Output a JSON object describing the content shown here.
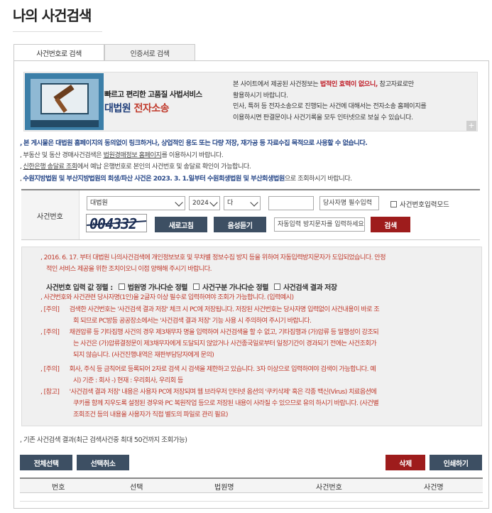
{
  "page": {
    "title": "나의 사건검색"
  },
  "tabs": [
    {
      "label": "사건번호로 검색",
      "active": true
    },
    {
      "label": "인증서로 검색",
      "active": false
    }
  ],
  "banner": {
    "tagline": "빠르고 편리한 고품질 사법서비스",
    "brand_part1": "대법원",
    "brand_part2": "전자소송",
    "text_line1_a": "본 사이트에서 제공된 사건정보는 ",
    "text_line1_em": "법적인 효력이 없으니,",
    "text_line1_b": " 참고자료로만",
    "text_line2": "활용하시기 바랍니다.",
    "text_line3": "민사, 특허 등 전자소송으로 진행되는 사건에 대해서는 전자소송 홈페이지를",
    "text_line4": "이용하시면 판결문이나 사건기록을 모두 인터넷으로 보실 수 있습니다.",
    "plus": "+"
  },
  "notices": {
    "n1": "본 게시물은 대법원 홈페이지의 동의없이 링크하거나, 상업적인 용도 또는 다량 저장, 재가공 등 자료수집 목적으로 사용할 수 없습니다.",
    "n2_a": "부동산 및 동산 경매사건검색은 ",
    "n2_link": "법원경매정보 홈페이지",
    "n2_b": "를 이용하시기 바랍니다.",
    "n3_link": "신한은행 송달료 조회",
    "n3_b": "에서 예납 은행번호로 본인의 사건번호 및 송달료 확인이 가능합니다.",
    "n4_a": "수원지방법원 및 부산지방법원의 회생/파산 사건은 2023. 3. 1.일부터 수원회생법원 및 부산회생법원",
    "n4_b": "으로 조회하시기 바랍니다."
  },
  "search": {
    "label": "사건번호",
    "court": "대법원",
    "year": "2024",
    "case_type": "다",
    "case_number": "",
    "party_placeholder": "당사자명 필수입력",
    "direct_input_label": "사건번호입력모드",
    "captcha_code": "004332",
    "refresh_label": "새로고침",
    "audio_label": "음성듣기",
    "captcha_placeholder": "자동입력 방지문자를 입력하세요",
    "search_label": "검색"
  },
  "info": {
    "l1": "2016. 6. 17. 부터 대법원 나의사건검색에 개인정보보호 및 무차별 정보수집 방지 등을 위하여 자동입력방지문자가 도입되었습니다. 안정",
    "l2": "적인 서비스 제공을 위한 조치이오니 이점 양해해 주시기 바랍니다.",
    "opt_title": "사건번호 입력 값 정렬 :",
    "opt1": "법원명 가나다순 정렬",
    "opt2": "사건구분 가나다순 정렬",
    "opt3": "사건검색 결과 저장",
    "r1": "사건번호와 사건관련 당사자명(1인)을 2글자 이상 필수로 입력하여야 조회가 가능합니다. (입력예시)",
    "tag_note": "[주의]",
    "tag_ref": "[참고]",
    "r2a": "검색한 사건번호는 '사건검색 결과 저장' 체크 시 PC에 저장됩니다. 저장된 사건번호는 당사자명 입력없이 사건내용이 바로 조",
    "r2b": "회 되므로 PC방등 공공장소에서는 '사건검색 결과 저장' 기능 사용 시 주의하여 주시기 바랍니다.",
    "r3a": "채권압류 등 기타집행 사건의 경우 제3채무자 명을 입력하여 사건검색을 할 수 없고, 기타집행과 (가)압류 등 밀행성이 강조되",
    "r3b": "는 사건은 (가)압류결정문이 제3채무자에게 도달되지 않았거나 사건종국일로부터 일정기간이 경과되기 전에는 사건조회가",
    "r3c": "되지 않습니다. (사건진행내역은 재판부담당자에게 문의)",
    "r4a": "회사, 주식 등 금칙어로 등록되어 2자로 검색 시 검색을 제한하고 있습니다. 3자 이상으로 입력하여야 검색이 가능합니다. 예",
    "r4b": "시) 기준 : 회사 -) 현재 : 우리회사, 우리회 등",
    "r5a": "'사건검색 결과 저장' 내용은 사용자 PC에 저장되며 웹 브라우저 인터넷 옵션의 '쿠키삭제' 혹은 각종 백신(Virus) 치료옵션에",
    "r5b": "쿠키를 함께 지우도록 설정된 경우와 PC 복원작업 등으로 저장된 내용이 사라질 수 있으므로 유의 하시기 바랍니다. (사건별",
    "r5c": "조회조건 등의 내용을 사용자가 직접 별도의 파일로 관리 필요)"
  },
  "results": {
    "label": "기존 사건검색 결과(최근 검색사건중 최대 50건까지 조회가능)",
    "select_all": "전체선택",
    "deselect": "선택취소",
    "delete": "삭제",
    "print": "인쇄하기",
    "columns": [
      "번호",
      "선택",
      "법원명",
      "사건번호",
      "사건명"
    ]
  }
}
